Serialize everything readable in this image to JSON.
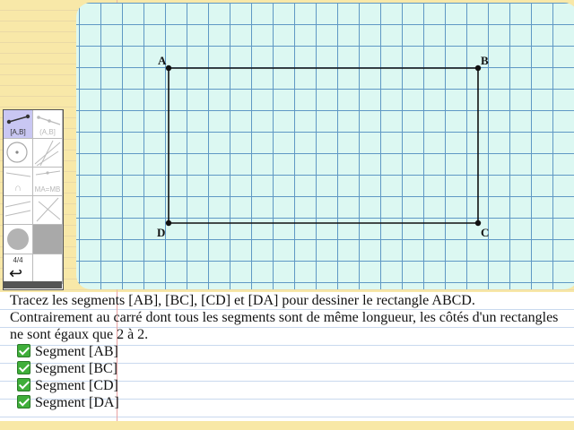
{
  "figure": {
    "points": [
      {
        "name": "A"
      },
      {
        "name": "B"
      },
      {
        "name": "C"
      },
      {
        "name": "D"
      }
    ]
  },
  "toolbar": {
    "tools": [
      {
        "icon": "segment-icon",
        "label": "[A,B]",
        "active": true
      },
      {
        "icon": "ray-icon",
        "label": "(A,B]",
        "active": false
      },
      {
        "icon": "circle-icon",
        "label": "",
        "active": false
      },
      {
        "icon": "lines-icon",
        "label": "",
        "active": false
      },
      {
        "icon": "intersection-icon",
        "label": "∩",
        "active": false
      },
      {
        "icon": "midpoint-icon",
        "label": "MA=MB",
        "active": false
      },
      {
        "icon": "parallel-icon",
        "label": "",
        "active": false
      },
      {
        "icon": "perpendicular-icon",
        "label": "",
        "active": false
      },
      {
        "icon": "color-circle-icon",
        "label": "",
        "active": false
      },
      {
        "icon": "fill-icon",
        "label": "",
        "active": false
      }
    ],
    "page_indicator": "4/4",
    "undo_icon": "undo-icon"
  },
  "instructions": {
    "line1": "Tracez les segments [AB], [BC], [CD] et [DA] pour dessiner le rectangle ABCD.",
    "line2": "Contrairement au carré dont tous les segments sont de même longueur, les côtés d'un rectangles ne sont égaux que 2 à 2."
  },
  "tasks": [
    {
      "label": "Segment [AB]",
      "done": true
    },
    {
      "label": "Segment [BC]",
      "done": true
    },
    {
      "label": "Segment [CD]",
      "done": true
    },
    {
      "label": "Segment [DA]",
      "done": true
    }
  ],
  "colors": {
    "accent_active_tool": "#c9c7f3",
    "grid_line": "#5f98c4",
    "canvas_bg": "#dcf8f2",
    "check_green": "#3fae3a"
  }
}
